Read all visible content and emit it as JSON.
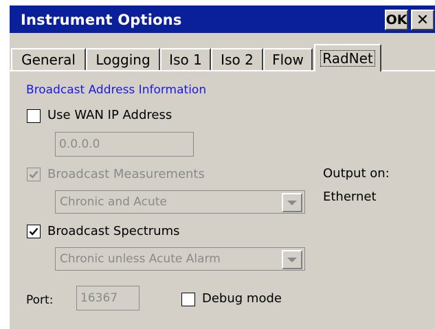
{
  "window": {
    "title": "Instrument Options",
    "ok_label": "OK",
    "close_glyph": "✕"
  },
  "tabs": [
    {
      "label": "General"
    },
    {
      "label": "Logging"
    },
    {
      "label": "Iso 1"
    },
    {
      "label": "Iso 2"
    },
    {
      "label": "Flow"
    },
    {
      "label": "RadNet"
    }
  ],
  "active_tab": "RadNet",
  "broadcast": {
    "section_title": "Broadcast Address Information",
    "use_wan_label": "Use WAN IP Address",
    "use_wan_checked": false,
    "ip_value": "0.0.0.0",
    "measurements_label": "Broadcast Measurements",
    "measurements_checked": true,
    "measurements_enabled": false,
    "measurements_mode": "Chronic and Acute",
    "spectrums_label": "Broadcast Spectrums",
    "spectrums_checked": true,
    "spectrums_mode": "Chronic unless Acute Alarm",
    "output_label": "Output on:",
    "output_value": "Ethernet",
    "port_label": "Port:",
    "port_value": "16367",
    "debug_label": "Debug mode",
    "debug_checked": false
  },
  "colors": {
    "title_bar": "#0a1f9a",
    "section_title": "#1a1adb",
    "face": "#d4d0c8",
    "disabled_text": "#8a8a8a"
  },
  "icons": {
    "close": "close-icon",
    "checkmark": "checkmark-icon",
    "dropdown": "chevron-down-icon"
  }
}
